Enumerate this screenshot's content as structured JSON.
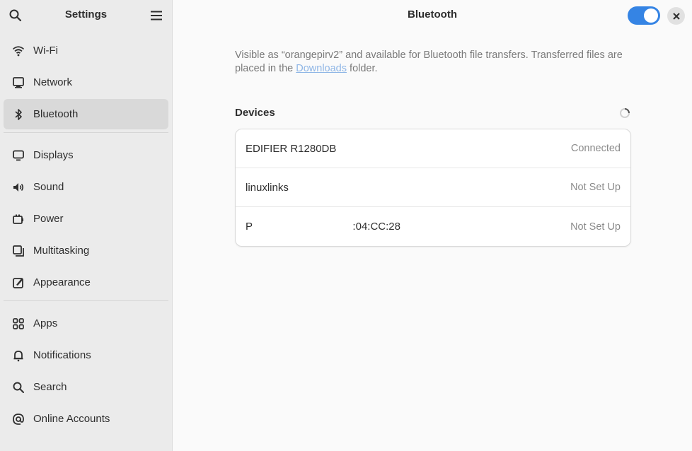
{
  "sidebar": {
    "title": "Settings",
    "groups": [
      [
        {
          "label": "Wi-Fi",
          "icon": "wifi-icon",
          "active": false
        },
        {
          "label": "Network",
          "icon": "network-icon",
          "active": false
        },
        {
          "label": "Bluetooth",
          "icon": "bluetooth-icon",
          "active": true
        }
      ],
      [
        {
          "label": "Displays",
          "icon": "display-icon",
          "active": false
        },
        {
          "label": "Sound",
          "icon": "sound-icon",
          "active": false
        },
        {
          "label": "Power",
          "icon": "power-icon",
          "active": false
        },
        {
          "label": "Multitasking",
          "icon": "multitasking-icon",
          "active": false
        },
        {
          "label": "Appearance",
          "icon": "appearance-icon",
          "active": false
        }
      ],
      [
        {
          "label": "Apps",
          "icon": "apps-icon",
          "active": false
        },
        {
          "label": "Notifications",
          "icon": "bell-icon",
          "active": false
        },
        {
          "label": "Search",
          "icon": "search-icon",
          "active": false
        },
        {
          "label": "Online Accounts",
          "icon": "at-icon",
          "active": false
        }
      ]
    ]
  },
  "main": {
    "title": "Bluetooth",
    "enabled": true,
    "description_pre": "Visible as “orangepirv2” and available for Bluetooth file transfers. Transferred files are placed in the ",
    "description_link": "Downloads",
    "description_post": " folder.",
    "devices_heading": "Devices",
    "devices": [
      {
        "name": "EDIFIER R1280DB",
        "status": "Connected"
      },
      {
        "name": "linuxlinks",
        "status": "Not Set Up"
      },
      {
        "name": "P                                  :04:CC:28",
        "status": "Not Set Up"
      }
    ]
  },
  "colors": {
    "accent": "#3584e4",
    "sidebar_bg": "#ebebeb",
    "active_bg": "#d9d9d9"
  }
}
